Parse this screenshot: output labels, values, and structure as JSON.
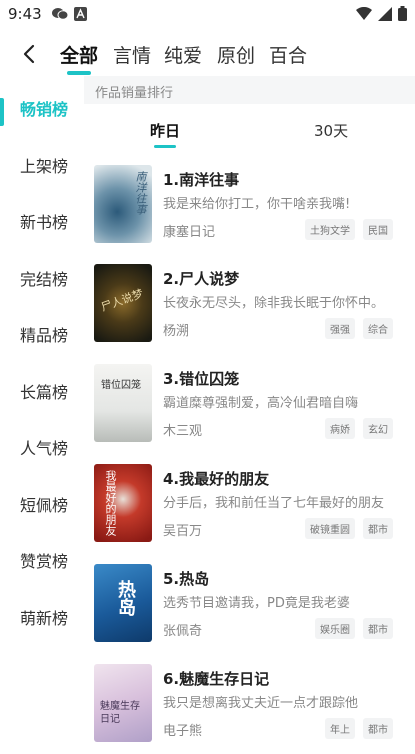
{
  "status_bar": {
    "time": "9:43",
    "left_icons": [
      "chat-bubble-icon",
      "font-a-icon"
    ],
    "right_icons": [
      "wifi-icon",
      "signal-icon",
      "battery-icon"
    ]
  },
  "top_nav": {
    "back_icon": "back-arrow-icon",
    "tabs": [
      {
        "label": "全部",
        "active": true
      },
      {
        "label": "言情",
        "active": false
      },
      {
        "label": "纯爱",
        "active": false
      },
      {
        "label": "原创",
        "active": false
      },
      {
        "label": "百合",
        "active": false
      }
    ]
  },
  "sidebar": {
    "items": [
      {
        "label": "畅销榜",
        "active": true
      },
      {
        "label": "上架榜",
        "active": false
      },
      {
        "label": "新书榜",
        "active": false
      },
      {
        "label": "完结榜",
        "active": false
      },
      {
        "label": "精品榜",
        "active": false
      },
      {
        "label": "长篇榜",
        "active": false
      },
      {
        "label": "人气榜",
        "active": false
      },
      {
        "label": "短佩榜",
        "active": false
      },
      {
        "label": "赞赏榜",
        "active": false
      },
      {
        "label": "萌新榜",
        "active": false
      }
    ]
  },
  "main": {
    "section_header": "作品销量排行",
    "sub_tabs": [
      {
        "label": "昨日",
        "active": true
      },
      {
        "label": "30天",
        "active": false
      }
    ],
    "books": [
      {
        "title": "1.南洋往事",
        "description": "我是来给你打工，你干啥亲我嘴!",
        "author": "康塞日记",
        "tags": [
          "土狗文学",
          "民国"
        ],
        "cover_text": "南洋往事"
      },
      {
        "title": "2.尸人说梦",
        "description": "长夜永无尽头，除非我长眠于你怀中。",
        "author": "杨溯",
        "tags": [
          "强强",
          "综合"
        ],
        "cover_text": "尸人说梦"
      },
      {
        "title": "3.错位囚笼",
        "description": "霸道糜尊强制爱，高冷仙君暗自嗨",
        "author": "木三观",
        "tags": [
          "病娇",
          "玄幻"
        ],
        "cover_text": "错位囚笼"
      },
      {
        "title": "4.我最好的朋友",
        "description": "分手后，我和前任当了七年最好的朋友",
        "author": "吴百万",
        "tags": [
          "破镜重圆",
          "都市"
        ],
        "cover_text": "我最好的朋友"
      },
      {
        "title": "5.热岛",
        "description": "选秀节目邀请我，PD竟是我老婆",
        "author": "张佩奇",
        "tags": [
          "娱乐圈",
          "都市"
        ],
        "cover_text": "热岛"
      },
      {
        "title": "6.魅魔生存日记",
        "description": "我只是想离我丈夫近一点才跟踪他",
        "author": "电子熊",
        "tags": [
          "年上",
          "都市"
        ],
        "cover_text": "魅魔生存日记"
      }
    ]
  },
  "colors": {
    "accent": "#1dc3c6",
    "header_bg": "#f5f6f7",
    "tag_bg": "#f2f3f4"
  }
}
